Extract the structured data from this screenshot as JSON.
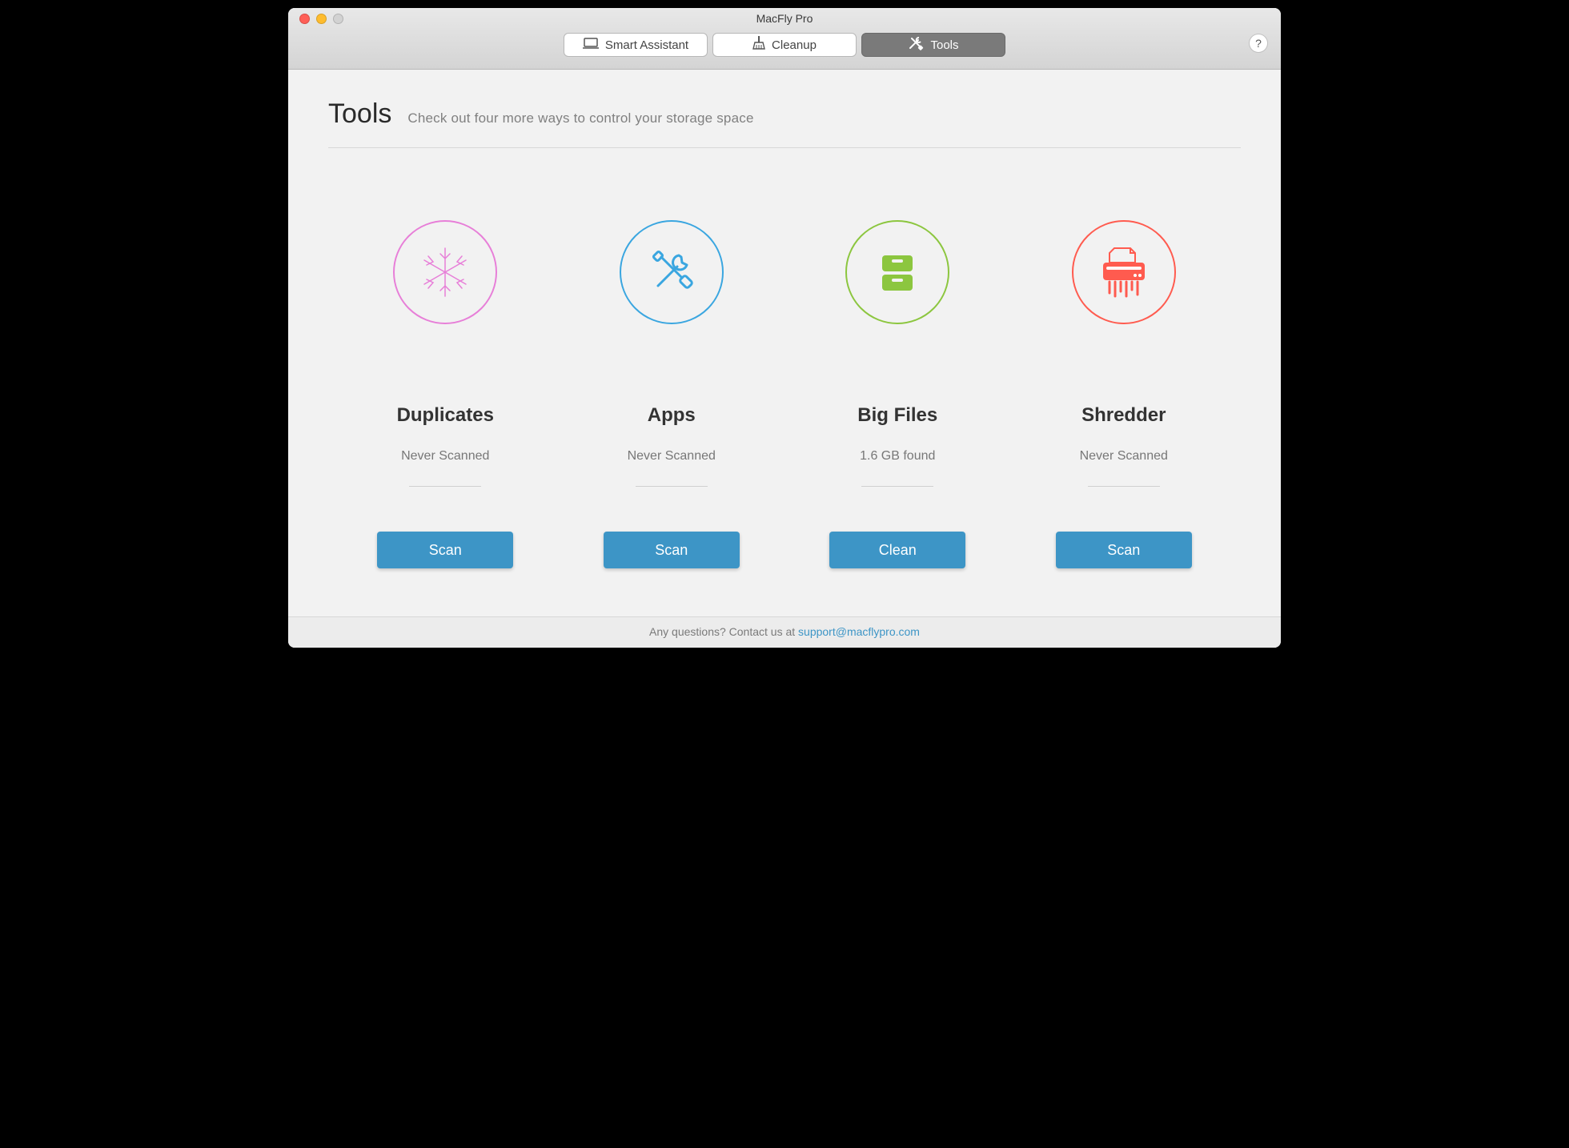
{
  "window": {
    "title": "MacFly Pro"
  },
  "tabs": {
    "smart_assistant": "Smart Assistant",
    "cleanup": "Cleanup",
    "tools": "Tools"
  },
  "help_label": "?",
  "page": {
    "title": "Tools",
    "subtitle": "Check out four more ways to control your storage space"
  },
  "cards": {
    "duplicates": {
      "title": "Duplicates",
      "status": "Never Scanned",
      "action": "Scan"
    },
    "apps": {
      "title": "Apps",
      "status": "Never Scanned",
      "action": "Scan"
    },
    "bigfiles": {
      "title": "Big Files",
      "status": "1.6 GB found",
      "action": "Clean"
    },
    "shredder": {
      "title": "Shredder",
      "status": "Never Scanned",
      "action": "Scan"
    }
  },
  "footer": {
    "prefix": "Any questions? Contact us at ",
    "email": "support@macflypro.com"
  }
}
